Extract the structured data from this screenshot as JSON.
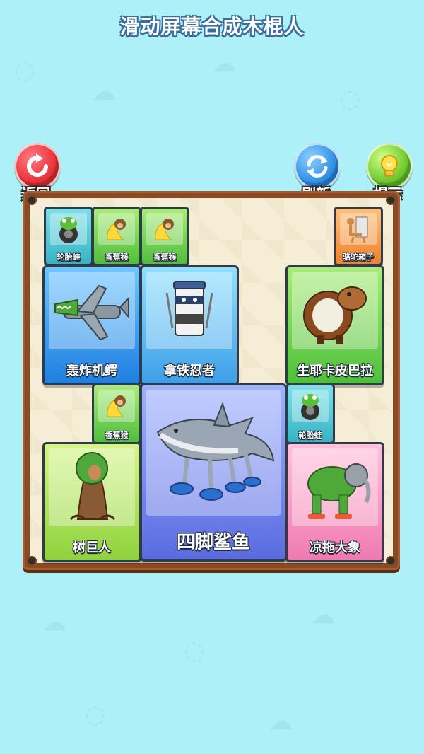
{
  "title": "滑动屏幕合成木棍人",
  "buttons": {
    "back": {
      "label": "返回",
      "icon": "restart-arrow-icon",
      "color": "#e8333a"
    },
    "refresh": {
      "label": "刷新",
      "icon": "refresh-arrows-icon",
      "color": "#2f8fe6"
    },
    "hint": {
      "label": "提示",
      "icon": "lightbulb-icon",
      "color": "#6cc82a"
    }
  },
  "cards": {
    "tire_frog_1": {
      "name": "轮胎蛙",
      "icon": "tire-frog-icon"
    },
    "banana_monkey_1": {
      "name": "香蕉猴",
      "icon": "banana-monkey-icon"
    },
    "banana_monkey_2": {
      "name": "香蕉猴",
      "icon": "banana-monkey-icon"
    },
    "camel_fridge": {
      "name": "骆驼箱子",
      "icon": "camel-fridge-icon"
    },
    "bomber_croc": {
      "name": "轰炸机鳄",
      "icon": "bomber-crocodile-icon"
    },
    "latte_ninja": {
      "name": "拿铁忍者",
      "icon": "latte-ninja-icon"
    },
    "capybara": {
      "name": "生耶卡皮巴拉",
      "icon": "capybara-icon"
    },
    "banana_monkey_3": {
      "name": "香蕉猴",
      "icon": "banana-monkey-icon"
    },
    "tire_frog_2": {
      "name": "轮胎蛙",
      "icon": "tire-frog-icon"
    },
    "tree_giant": {
      "name": "树巨人",
      "icon": "tree-giant-icon"
    },
    "shark": {
      "name": "四脚鲨鱼",
      "icon": "shark-with-shoes-icon"
    },
    "sandal_elephant": {
      "name": "凉拖大象",
      "icon": "elephant-sandals-icon"
    }
  }
}
